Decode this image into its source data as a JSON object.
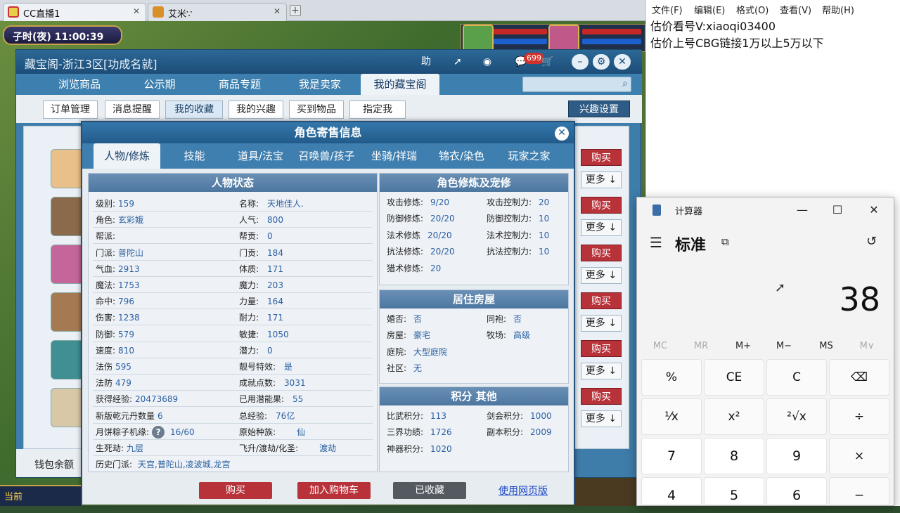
{
  "browser": {
    "tabs": [
      {
        "label": "CC直播1",
        "active": true
      },
      {
        "label": "艾米∵",
        "active": false
      }
    ],
    "new_tab": "+"
  },
  "game": {
    "clock": "子时(夜)  11:00:39",
    "bottom_left": "当前"
  },
  "window": {
    "title": "藏宝阁-浙江3区[功成名就]",
    "help_label": "助",
    "message_badge": "699",
    "nav_tabs": [
      "浏览商品",
      "公示期",
      "商品专题",
      "我是卖家",
      "我的藏宝阁"
    ],
    "nav_active": 4,
    "sub_tabs": [
      "订单管理",
      "消息提醒",
      "我的收藏",
      "我的兴趣",
      "买到物品",
      "指定我"
    ],
    "sub_active": 2,
    "interest_settings": "兴趣设置",
    "list_buttons": {
      "buy": "购买",
      "more": "更多 ↓"
    },
    "wallet": "钱包余额"
  },
  "modal": {
    "title": "角色寄售信息",
    "close": "✕",
    "tabs": [
      "人物/修炼",
      "技能",
      "道具/法宝",
      "召唤兽/孩子",
      "坐骑/祥瑞",
      "锦衣/染色",
      "玩家之家"
    ],
    "tab_active": 0,
    "status_panel": {
      "title": "人物状态",
      "left": [
        {
          "k": "级别:",
          "v": "159"
        },
        {
          "k": "角色:",
          "v": "玄彩娥"
        },
        {
          "k": "帮派:",
          "v": ""
        },
        {
          "k": "门派:",
          "v": "普陀山"
        },
        {
          "k": "气血:",
          "v": "2913"
        },
        {
          "k": "魔法:",
          "v": "1753"
        },
        {
          "k": "命中:",
          "v": "796"
        },
        {
          "k": "伤害:",
          "v": "1238"
        },
        {
          "k": "防御:",
          "v": "579"
        },
        {
          "k": "速度:",
          "v": "810"
        },
        {
          "k": "法伤",
          "v": "595"
        },
        {
          "k": "法防",
          "v": "479"
        },
        {
          "k": "获得经验:",
          "v": "20473689"
        },
        {
          "k": "新版乾元丹数量",
          "v": "6"
        },
        {
          "k": "月饼粽子机缘:",
          "v": "16/60"
        },
        {
          "k": "生死劫:",
          "v": "九层"
        }
      ],
      "right": [
        {
          "k": "名称:",
          "v": "天地佳人."
        },
        {
          "k": "人气:",
          "v": "800"
        },
        {
          "k": "帮贡:",
          "v": "0"
        },
        {
          "k": "门贡:",
          "v": "184"
        },
        {
          "k": "体质:",
          "v": "171"
        },
        {
          "k": "魔力:",
          "v": "203"
        },
        {
          "k": "力量:",
          "v": "164"
        },
        {
          "k": "耐力:",
          "v": "171"
        },
        {
          "k": "敏捷:",
          "v": "1050"
        },
        {
          "k": "潜力:",
          "v": "0"
        },
        {
          "k": "靓号特效:",
          "v": "是"
        },
        {
          "k": "成就点数:",
          "v": "3031"
        },
        {
          "k": "已用潜能果:",
          "v": "55"
        },
        {
          "k": "总经验:",
          "v": "76亿"
        },
        {
          "k": "原始种族:",
          "v": "仙"
        },
        {
          "k": "飞升/渡劫/化圣:",
          "v": "渡劫"
        }
      ],
      "history": {
        "k": "历史门派:",
        "v": "天宫,普陀山,凌波城,龙宫"
      }
    },
    "cultivation_panel": {
      "title": "角色修炼及宠修",
      "rows": [
        {
          "k1": "攻击修炼:",
          "v1": "9/20",
          "k2": "攻击控制力:",
          "v2": "20"
        },
        {
          "k1": "防御修炼:",
          "v1": "20/20",
          "k2": "防御控制力:",
          "v2": "10"
        },
        {
          "k1": "法术修炼",
          "v1": "20/20",
          "k2": "法术控制力:",
          "v2": "10"
        },
        {
          "k1": "抗法修炼:",
          "v1": "20/20",
          "k2": "抗法控制力:",
          "v2": "10"
        },
        {
          "k1": "猎术修炼:",
          "v1": "20",
          "k2": "",
          "v2": ""
        }
      ]
    },
    "house_panel": {
      "title": "居住房屋",
      "rows": [
        {
          "k1": "婚否:",
          "v1": "否",
          "k2": "同袍:",
          "v2": "否"
        },
        {
          "k1": "房屋:",
          "v1": "豪宅",
          "k2": "牧场:",
          "v2": "高级"
        },
        {
          "k1": "庭院:",
          "v1": "大型庭院",
          "k2": "",
          "v2": ""
        },
        {
          "k1": "社区:",
          "v1": "无",
          "k2": "",
          "v2": ""
        }
      ]
    },
    "score_panel": {
      "title": "积分 其他",
      "rows": [
        {
          "k1": "比武积分:",
          "v1": "113",
          "k2": "剑会积分:",
          "v2": "1000"
        },
        {
          "k1": "三界功绩:",
          "v1": "1726",
          "k2": "副本积分:",
          "v2": "2009"
        },
        {
          "k1": "神器积分:",
          "v1": "1020",
          "k2": "",
          "v2": ""
        }
      ]
    },
    "footer": {
      "buy": "购买",
      "add_cart": "加入购物车",
      "collected": "已收藏",
      "web": "使用网页版"
    }
  },
  "notepad": {
    "menu": [
      "文件(F)",
      "编辑(E)",
      "格式(O)",
      "查看(V)",
      "帮助(H)"
    ],
    "lines": [
      "估价看号V:xiaoqi03400",
      "估价上号CBG链接1万以上5万以下"
    ]
  },
  "calculator": {
    "title": "计算器",
    "mode": "标准",
    "display": "38",
    "memory": [
      "MC",
      "MR",
      "M+",
      "M−",
      "MS",
      "M∨"
    ],
    "keys": [
      "%",
      "CE",
      "C",
      "⌫",
      "¹⁄x",
      "x²",
      "²√x",
      "÷",
      "7",
      "8",
      "9",
      "×",
      "4",
      "5",
      "6",
      "−"
    ]
  },
  "colors": {
    "window_blue": "#3e7caa",
    "buy_red": "#b8323a",
    "value_blue": "#2a5fa2",
    "link_blue": "#1a46c8"
  }
}
